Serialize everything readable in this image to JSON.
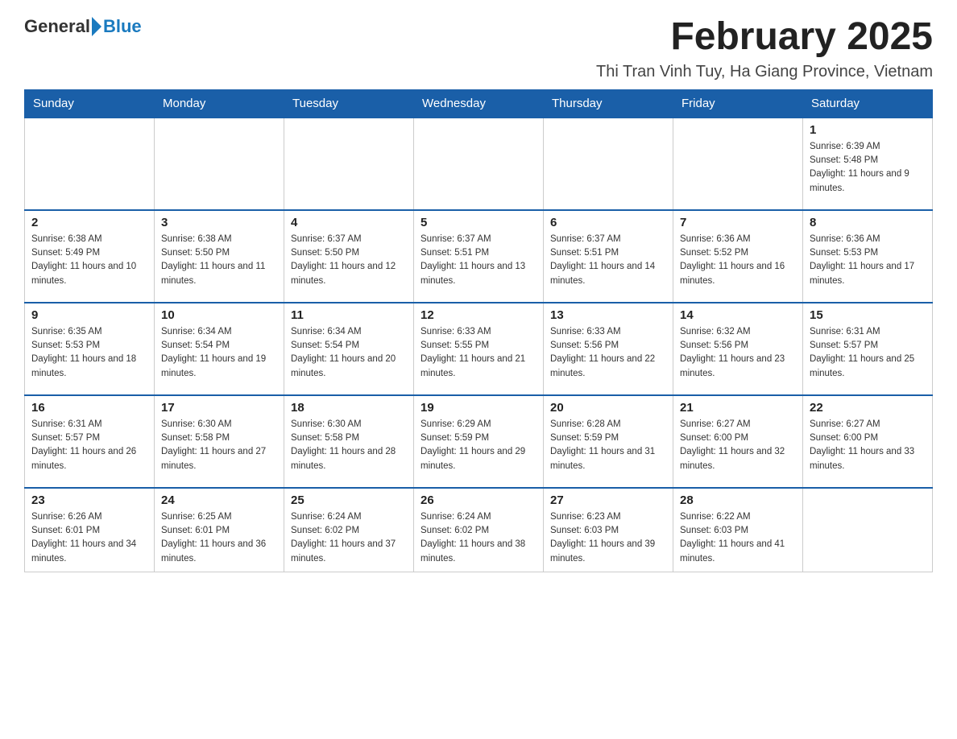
{
  "header": {
    "logo_general": "General",
    "logo_blue": "Blue",
    "title": "February 2025",
    "subtitle": "Thi Tran Vinh Tuy, Ha Giang Province, Vietnam"
  },
  "weekdays": [
    "Sunday",
    "Monday",
    "Tuesday",
    "Wednesday",
    "Thursday",
    "Friday",
    "Saturday"
  ],
  "weeks": [
    [
      {
        "day": "",
        "info": ""
      },
      {
        "day": "",
        "info": ""
      },
      {
        "day": "",
        "info": ""
      },
      {
        "day": "",
        "info": ""
      },
      {
        "day": "",
        "info": ""
      },
      {
        "day": "",
        "info": ""
      },
      {
        "day": "1",
        "info": "Sunrise: 6:39 AM\nSunset: 5:48 PM\nDaylight: 11 hours and 9 minutes."
      }
    ],
    [
      {
        "day": "2",
        "info": "Sunrise: 6:38 AM\nSunset: 5:49 PM\nDaylight: 11 hours and 10 minutes."
      },
      {
        "day": "3",
        "info": "Sunrise: 6:38 AM\nSunset: 5:50 PM\nDaylight: 11 hours and 11 minutes."
      },
      {
        "day": "4",
        "info": "Sunrise: 6:37 AM\nSunset: 5:50 PM\nDaylight: 11 hours and 12 minutes."
      },
      {
        "day": "5",
        "info": "Sunrise: 6:37 AM\nSunset: 5:51 PM\nDaylight: 11 hours and 13 minutes."
      },
      {
        "day": "6",
        "info": "Sunrise: 6:37 AM\nSunset: 5:51 PM\nDaylight: 11 hours and 14 minutes."
      },
      {
        "day": "7",
        "info": "Sunrise: 6:36 AM\nSunset: 5:52 PM\nDaylight: 11 hours and 16 minutes."
      },
      {
        "day": "8",
        "info": "Sunrise: 6:36 AM\nSunset: 5:53 PM\nDaylight: 11 hours and 17 minutes."
      }
    ],
    [
      {
        "day": "9",
        "info": "Sunrise: 6:35 AM\nSunset: 5:53 PM\nDaylight: 11 hours and 18 minutes."
      },
      {
        "day": "10",
        "info": "Sunrise: 6:34 AM\nSunset: 5:54 PM\nDaylight: 11 hours and 19 minutes."
      },
      {
        "day": "11",
        "info": "Sunrise: 6:34 AM\nSunset: 5:54 PM\nDaylight: 11 hours and 20 minutes."
      },
      {
        "day": "12",
        "info": "Sunrise: 6:33 AM\nSunset: 5:55 PM\nDaylight: 11 hours and 21 minutes."
      },
      {
        "day": "13",
        "info": "Sunrise: 6:33 AM\nSunset: 5:56 PM\nDaylight: 11 hours and 22 minutes."
      },
      {
        "day": "14",
        "info": "Sunrise: 6:32 AM\nSunset: 5:56 PM\nDaylight: 11 hours and 23 minutes."
      },
      {
        "day": "15",
        "info": "Sunrise: 6:31 AM\nSunset: 5:57 PM\nDaylight: 11 hours and 25 minutes."
      }
    ],
    [
      {
        "day": "16",
        "info": "Sunrise: 6:31 AM\nSunset: 5:57 PM\nDaylight: 11 hours and 26 minutes."
      },
      {
        "day": "17",
        "info": "Sunrise: 6:30 AM\nSunset: 5:58 PM\nDaylight: 11 hours and 27 minutes."
      },
      {
        "day": "18",
        "info": "Sunrise: 6:30 AM\nSunset: 5:58 PM\nDaylight: 11 hours and 28 minutes."
      },
      {
        "day": "19",
        "info": "Sunrise: 6:29 AM\nSunset: 5:59 PM\nDaylight: 11 hours and 29 minutes."
      },
      {
        "day": "20",
        "info": "Sunrise: 6:28 AM\nSunset: 5:59 PM\nDaylight: 11 hours and 31 minutes."
      },
      {
        "day": "21",
        "info": "Sunrise: 6:27 AM\nSunset: 6:00 PM\nDaylight: 11 hours and 32 minutes."
      },
      {
        "day": "22",
        "info": "Sunrise: 6:27 AM\nSunset: 6:00 PM\nDaylight: 11 hours and 33 minutes."
      }
    ],
    [
      {
        "day": "23",
        "info": "Sunrise: 6:26 AM\nSunset: 6:01 PM\nDaylight: 11 hours and 34 minutes."
      },
      {
        "day": "24",
        "info": "Sunrise: 6:25 AM\nSunset: 6:01 PM\nDaylight: 11 hours and 36 minutes."
      },
      {
        "day": "25",
        "info": "Sunrise: 6:24 AM\nSunset: 6:02 PM\nDaylight: 11 hours and 37 minutes."
      },
      {
        "day": "26",
        "info": "Sunrise: 6:24 AM\nSunset: 6:02 PM\nDaylight: 11 hours and 38 minutes."
      },
      {
        "day": "27",
        "info": "Sunrise: 6:23 AM\nSunset: 6:03 PM\nDaylight: 11 hours and 39 minutes."
      },
      {
        "day": "28",
        "info": "Sunrise: 6:22 AM\nSunset: 6:03 PM\nDaylight: 11 hours and 41 minutes."
      },
      {
        "day": "",
        "info": ""
      }
    ]
  ]
}
